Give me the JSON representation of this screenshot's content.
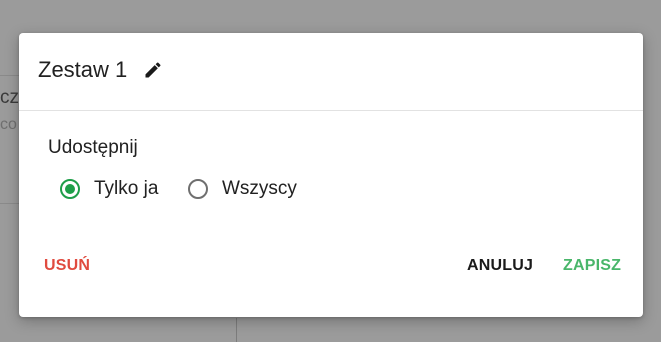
{
  "background": {
    "fragment_title": "cz",
    "fragment_sub": "co"
  },
  "dialog": {
    "title": "Zestaw 1",
    "edit_icon": "pencil-icon",
    "share_label": "Udostępnij",
    "options": [
      {
        "label": "Tylko ja",
        "checked": true
      },
      {
        "label": "Wszyscy",
        "checked": false
      }
    ],
    "actions": {
      "delete": "USUŃ",
      "cancel": "ANULUJ",
      "save": "ZAPISZ"
    }
  },
  "colors": {
    "overlay": "#9b9b9b",
    "accent": "#1e9e49",
    "save": "#49b66a",
    "delete": "#e04b3f"
  }
}
